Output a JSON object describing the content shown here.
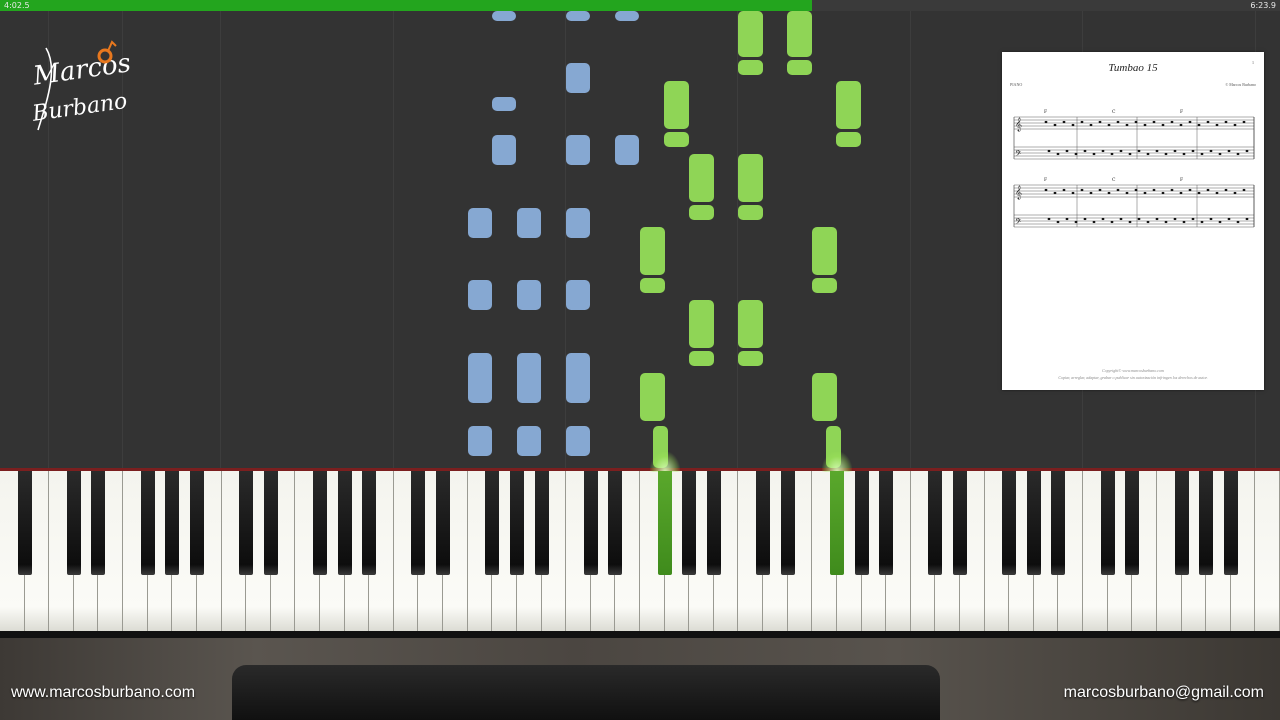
{
  "progress": {
    "elapsed": "4:02.5",
    "total": "6:23.9",
    "fraction": 0.634
  },
  "logo": {
    "line1": "Marcos",
    "line2": "Burbano",
    "accent_color": "#e8781e"
  },
  "sheet": {
    "title": "Tumbao 15",
    "instrument": "PIANO",
    "composer": "© Marcos Burbano",
    "page_number": "1",
    "chord_row1": [
      "F",
      "C",
      "F"
    ],
    "chord_row2": [
      "F",
      "C",
      "F"
    ],
    "copyright_line1": "Copyright© www.marcosburbano.com",
    "copyright_line2": "Copiar, arreglar, adaptar, grabar o publicar sin autorización infringen los derechos de autor."
  },
  "colors": {
    "left_hand": "#86a8d2",
    "right_hand": "#8fd556",
    "progress_bar": "#23a51e"
  },
  "footer": {
    "website": "www.marcosburbano.com",
    "email": "marcosburbano@gmail.com"
  }
}
